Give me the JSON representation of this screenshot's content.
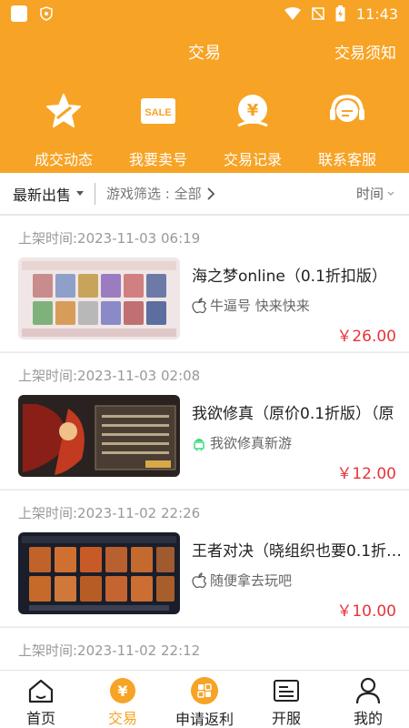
{
  "status_bar": {
    "time": "11:43"
  },
  "header": {
    "title": "交易",
    "notice": "交易须知"
  },
  "quick_actions": [
    {
      "label": "成交动态",
      "icon": "star-icon"
    },
    {
      "label": "我要卖号",
      "icon": "sale-tag-icon"
    },
    {
      "label": "交易记录",
      "icon": "yen-coin-icon"
    },
    {
      "label": "联系客服",
      "icon": "headset-icon"
    }
  ],
  "filters": {
    "sort": "最新出售",
    "game_filter": "游戏筛选 : 全部",
    "time": "时间"
  },
  "listings": [
    {
      "time": "上架时间:2023-11-03 06:19",
      "title": "海之梦online（0.1折扣版）",
      "platform": "ios",
      "seller": "牛逼号 快来快来",
      "price": "￥26.00"
    },
    {
      "time": "上架时间:2023-11-03 02:08",
      "title": "我欲修真（原价0.1折版）（原",
      "platform": "android",
      "seller": "我欲修真新游",
      "price": "￥12.00"
    },
    {
      "time": "上架时间:2023-11-02 22:26",
      "title": "王者对决（晓组织也要0.1折…",
      "platform": "ios",
      "seller": "随便拿去玩吧",
      "price": "￥10.00"
    },
    {
      "time": "上架时间:2023-11-02 22:12",
      "title": "",
      "platform": "",
      "seller": "",
      "price": ""
    }
  ],
  "tabbar": [
    {
      "label": "首页",
      "icon": "home-icon"
    },
    {
      "label": "交易",
      "icon": "yen-icon",
      "active": true
    },
    {
      "label": "申请返利",
      "icon": "rebate-icon"
    },
    {
      "label": "开服",
      "icon": "server-icon"
    },
    {
      "label": "我的",
      "icon": "user-icon"
    }
  ],
  "colors": {
    "brand": "#f7a325",
    "price": "#e8333a"
  }
}
